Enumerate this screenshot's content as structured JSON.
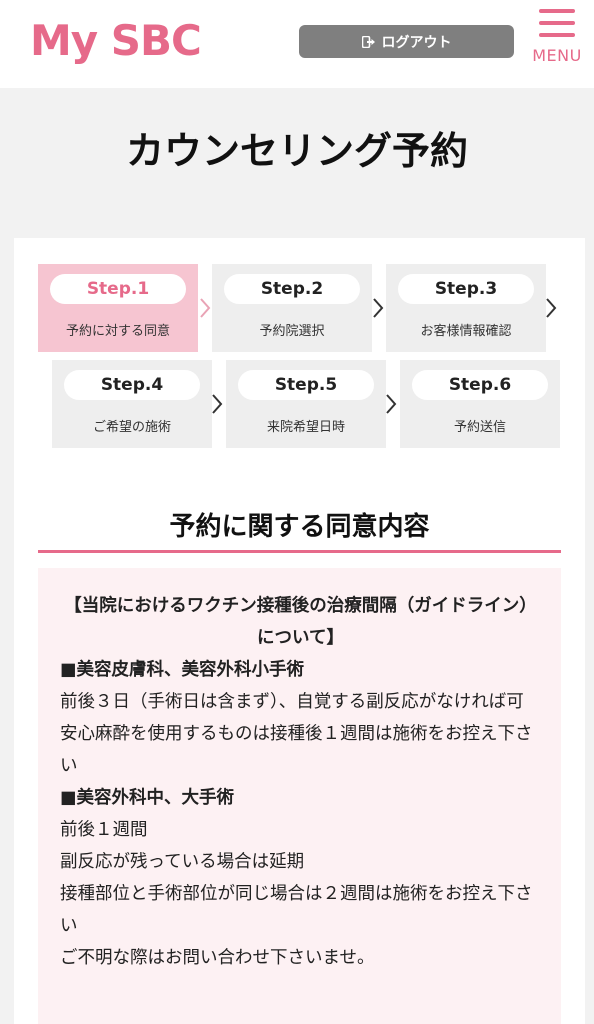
{
  "header": {
    "logo": "My SBC",
    "logout_label": "ログアウト",
    "menu_label": "MENU",
    "accent_color": "#e66a8a"
  },
  "page_title": "カウンセリング予約",
  "steps": [
    {
      "step": "Step.1",
      "label": "予約に対する同意",
      "active": true
    },
    {
      "step": "Step.2",
      "label": "予約院選択",
      "active": false
    },
    {
      "step": "Step.3",
      "label": "お客様情報確認",
      "active": false
    },
    {
      "step": "Step.4",
      "label": "ご希望の施術",
      "active": false
    },
    {
      "step": "Step.5",
      "label": "来院希望日時",
      "active": false
    },
    {
      "step": "Step.6",
      "label": "予約送信",
      "active": false
    }
  ],
  "section": {
    "title": "予約に関する同意内容",
    "heading": "【当院におけるワクチン接種後の治療間隔（ガイドライン）について】",
    "minor_title": "■美容皮膚科、美容外科小手術",
    "minor_line1": "前後３日（手術日は含まず）、自覚する副反応がなければ可",
    "minor_line2": "安心麻酔を使用するものは接種後１週間は施術をお控え下さい",
    "major_title": "■美容外科中、大手術",
    "major_line1": "前後１週間",
    "major_line2": "副反応が残っている場合は延期",
    "major_line3": "接種部位と手術部位が同じ場合は２週間は施術をお控え下さい",
    "closing": "ご不明な際はお問い合わせ下さいませ。"
  }
}
